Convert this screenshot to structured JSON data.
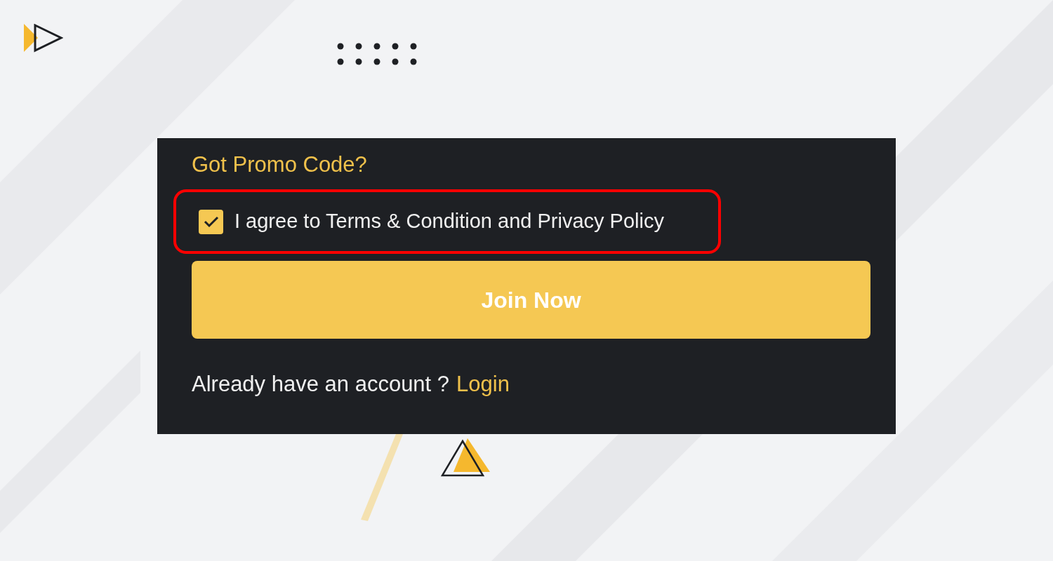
{
  "promo_link": "Got Promo Code?",
  "agreement": {
    "checked": true,
    "text": "I agree to Terms & Condition and Privacy Policy"
  },
  "join_button": "Join Now",
  "login_prompt": {
    "text": "Already have an account ?",
    "link": "Login"
  }
}
